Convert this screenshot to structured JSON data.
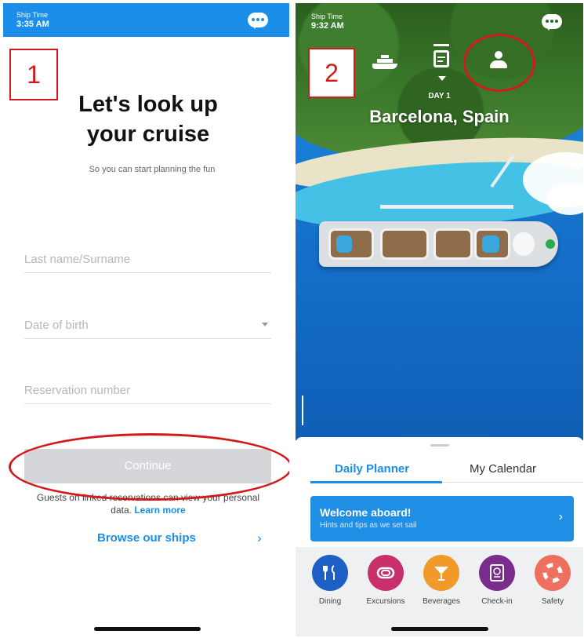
{
  "left_screen": {
    "annotation_number": "1",
    "status": {
      "label": "Ship Time",
      "time": "3:35 AM"
    },
    "title": "Let's look up your cruise",
    "subtitle": "So you can start planning the fun",
    "fields": {
      "last_name_placeholder": "Last name/Surname",
      "dob_placeholder": "Date of birth",
      "reservation_placeholder": "Reservation number"
    },
    "continue_label": "Continue",
    "note_text": "Guests on linked reservations can view your personal data.",
    "note_link": "Learn more",
    "browse_label": "Browse our ships",
    "browse_chevron": "›",
    "colors": {
      "accent": "#1a8ee8",
      "annotation": "#d11b1b"
    }
  },
  "right_screen": {
    "annotation_number": "2",
    "status": {
      "label": "Ship Time",
      "time": "9:32 AM"
    },
    "header_icons": [
      "ship-icon",
      "calendar-icon",
      "person-icon"
    ],
    "day_label": "DAY 1",
    "port": "Barcelona, Spain",
    "tabs": {
      "active": "Daily Planner",
      "inactive": "My Calendar"
    },
    "welcome": {
      "title": "Welcome aboard!",
      "subtitle": "Hints and tips as we set sail",
      "chevron": "›"
    },
    "quick_actions": [
      {
        "label": "Dining",
        "icon": "fork-knife-icon",
        "color": "#1d5fc4"
      },
      {
        "label": "Excursions",
        "icon": "snorkel-icon",
        "color": "#c9306b"
      },
      {
        "label": "Beverages",
        "icon": "cocktail-icon",
        "color": "#f19a2a"
      },
      {
        "label": "Check-in",
        "icon": "passport-icon",
        "color": "#7b2d8e"
      },
      {
        "label": "Safety",
        "icon": "life-ring-icon",
        "color": "#ef6f5f"
      }
    ]
  }
}
